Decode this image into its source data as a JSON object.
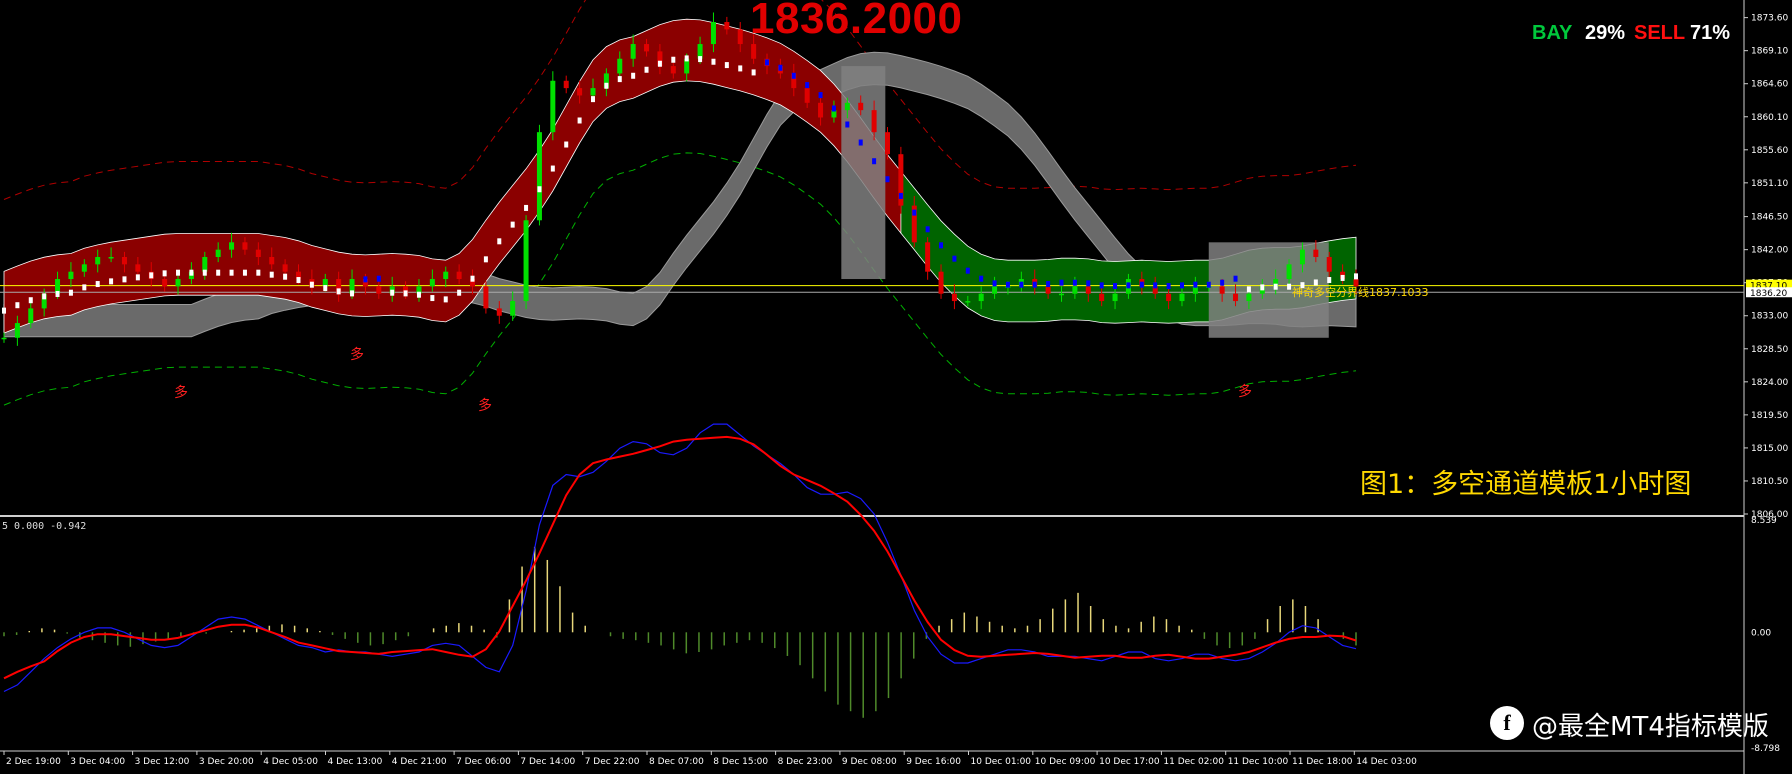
{
  "header": {
    "big_price": "1836.2000",
    "bay_label": "BAY",
    "bay_value": "29%",
    "sell_label": "SELL",
    "sell_value": "71%"
  },
  "caption": "图1：多空通道模板1小时图",
  "pivot_label": "神奇多空分界线1837.1033",
  "indicator_label": "5 0.000 -0.942",
  "watermark": "@最全MT4指标模版",
  "watermark_icon": "f",
  "markers": [
    "多",
    "多",
    "多",
    "多"
  ],
  "colors": {
    "background": "#000000",
    "bull_candle": "#00e000",
    "bear_candle": "#e00000",
    "channel_red": "#8b0000",
    "channel_green": "#006400",
    "channel_gray": "#808080",
    "signal_white": "#ffffff",
    "signal_blue": "#0000ff",
    "price_line": "#ffff00",
    "macd_red": "#ff0000",
    "macd_blue": "#1a1aff"
  },
  "chart_data": [
    {
      "type": "candlestick",
      "title": "",
      "y_ticks": [
        1873.6,
        1869.1,
        1864.6,
        1860.1,
        1855.6,
        1851.1,
        1846.5,
        1842.0,
        1837.5,
        1833.0,
        1828.5,
        1824.0,
        1819.5,
        1815.0,
        1810.5,
        1806.0
      ],
      "ylim": [
        1806.0,
        1876.0
      ],
      "current_price_tag": "1837.10",
      "second_price_tag": "1836.20",
      "x_ticks": [
        "2 Dec 19:00",
        "3 Dec 04:00",
        "3 Dec 12:00",
        "3 Dec 20:00",
        "4 Dec 05:00",
        "4 Dec 13:00",
        "4 Dec 21:00",
        "7 Dec 06:00",
        "7 Dec 14:00",
        "7 Dec 22:00",
        "8 Dec 07:00",
        "8 Dec 15:00",
        "8 Dec 23:00",
        "9 Dec 08:00",
        "9 Dec 16:00",
        "10 Dec 01:00",
        "10 Dec 09:00",
        "10 Dec 17:00",
        "11 Dec 02:00",
        "11 Dec 10:00",
        "11 Dec 18:00",
        "14 Dec 03:00"
      ],
      "close_path": [
        1830,
        1832,
        1834,
        1836,
        1838,
        1839,
        1840,
        1841,
        1841,
        1840,
        1839,
        1838,
        1837,
        1838,
        1839,
        1841,
        1842,
        1843,
        1842,
        1841,
        1840,
        1839,
        1838,
        1837,
        1838,
        1836,
        1838,
        1837,
        1836,
        1837,
        1836,
        1837,
        1838,
        1839,
        1838,
        1837,
        1834,
        1833,
        1835,
        1846,
        1858,
        1865,
        1864,
        1863,
        1864,
        1866,
        1868,
        1870,
        1869,
        1867,
        1866,
        1868,
        1870,
        1873,
        1872,
        1870,
        1868,
        1867,
        1866,
        1864,
        1862,
        1860,
        1861,
        1862,
        1861,
        1858,
        1855,
        1848,
        1843,
        1839,
        1836,
        1835,
        1835,
        1836,
        1837,
        1837,
        1838,
        1837,
        1836,
        1836,
        1837,
        1836,
        1835,
        1836,
        1838,
        1837,
        1836,
        1835,
        1836,
        1837,
        1837,
        1836,
        1835,
        1836,
        1837,
        1838,
        1840,
        1842,
        1841,
        1839,
        1838,
        1837
      ]
    },
    {
      "type": "bar",
      "title": "",
      "y_ticks": [
        8.539,
        0.0,
        -8.798
      ],
      "ylim": [
        -8.798,
        8.539
      ],
      "histogram": [
        -0.3,
        -0.2,
        0.1,
        0.3,
        0.2,
        -0.1,
        -0.4,
        -0.6,
        -0.8,
        -1.0,
        -1.1,
        -0.9,
        -0.7,
        -0.5,
        -0.3,
        -0.2,
        -0.1,
        0.0,
        0.1,
        0.2,
        0.3,
        0.5,
        0.6,
        0.5,
        0.3,
        0.1,
        -0.2,
        -0.5,
        -0.8,
        -1.0,
        -0.9,
        -0.6,
        -0.3,
        0.0,
        0.3,
        0.5,
        0.7,
        0.5,
        0.2,
        -0.4,
        2.5,
        5.0,
        6.5,
        5.5,
        3.5,
        1.5,
        0.5,
        0.0,
        -0.3,
        -0.5,
        -0.6,
        -0.8,
        -1.0,
        -1.3,
        -1.6,
        -1.5,
        -1.3,
        -1.0,
        -0.8,
        -0.6,
        -0.8,
        -1.2,
        -1.8,
        -2.5,
        -3.5,
        -4.5,
        -5.5,
        -6.0,
        -6.5,
        -6.0,
        -5.0,
        -3.5,
        -2.0,
        -0.5,
        0.5,
        1.0,
        1.5,
        1.2,
        0.8,
        0.5,
        0.3,
        0.5,
        1.0,
        1.8,
        2.5,
        3.0,
        2.0,
        1.0,
        0.5,
        0.3,
        0.8,
        1.2,
        1.0,
        0.5,
        0.2,
        -0.5,
        -1.0,
        -1.2,
        -1.0,
        -0.5,
        1.0,
        2.0,
        2.5,
        2.0,
        1.0,
        0.0,
        -0.5,
        -1.0
      ]
    }
  ]
}
